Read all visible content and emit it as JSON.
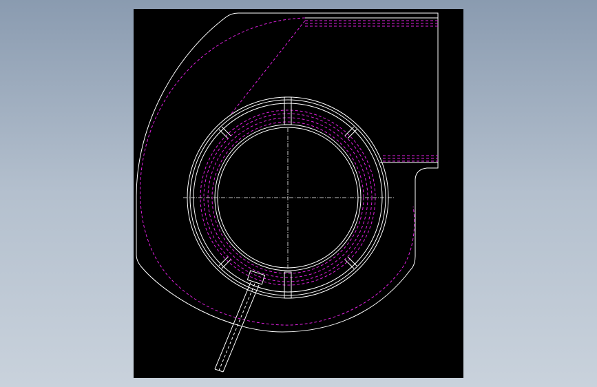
{
  "colors": {
    "background": "#8a9bb0",
    "viewport": "#000000",
    "outline": "#ffffff",
    "hidden_lines": "#e020e0",
    "centerline": "#ffffff"
  }
}
